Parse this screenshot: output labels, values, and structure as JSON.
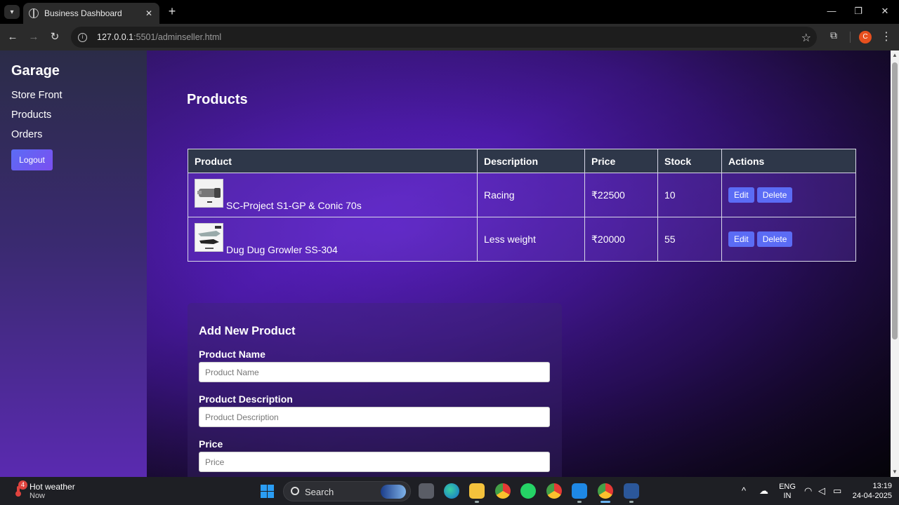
{
  "browser": {
    "tab_title": "Business Dashboard",
    "tab_close": "✕",
    "new_tab": "+",
    "url_host": "127.0.0.1",
    "url_path": ":5501/adminseller.html",
    "profile_initial": "C"
  },
  "sidebar": {
    "brand": "Garage",
    "links": [
      {
        "label": "Store Front"
      },
      {
        "label": "Products"
      },
      {
        "label": "Orders"
      }
    ],
    "logout_label": "Logout"
  },
  "main": {
    "title": "Products",
    "table": {
      "headers": [
        "Product",
        "Description",
        "Price",
        "Stock",
        "Actions"
      ],
      "rows": [
        {
          "name": "SC-Project S1-GP & Conic 70s",
          "description": "Racing",
          "price": "₹22500",
          "stock": "10",
          "edit": "Edit",
          "delete": "Delete"
        },
        {
          "name": "Dug Dug Growler SS-304",
          "description": "Less weight",
          "price": "₹20000",
          "stock": "55",
          "edit": "Edit",
          "delete": "Delete"
        }
      ]
    },
    "form": {
      "heading": "Add New Product",
      "fields": [
        {
          "label": "Product Name",
          "placeholder": "Product Name"
        },
        {
          "label": "Product Description",
          "placeholder": "Product Description"
        },
        {
          "label": "Price",
          "placeholder": "Price"
        }
      ]
    }
  },
  "taskbar": {
    "weather_badge": "4",
    "weather_title": "Hot weather",
    "weather_sub": "Now",
    "search_label": "Search",
    "lang_top": "ENG",
    "lang_bottom": "IN",
    "time": "13:19",
    "date": "24-04-2025"
  },
  "colors": {
    "accent_button": "#5b6cf5",
    "table_header": "#2e3749",
    "brand_bg": "#5d22c6"
  }
}
